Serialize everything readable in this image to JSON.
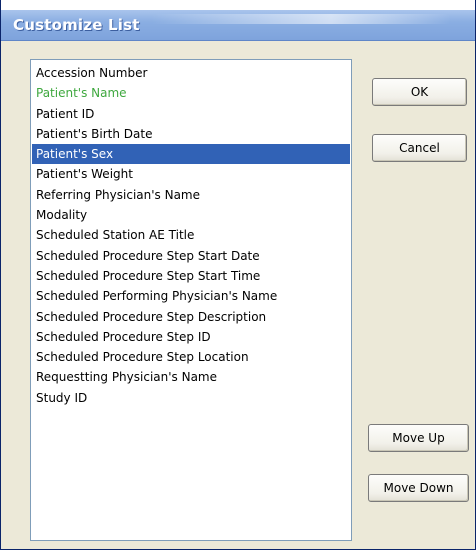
{
  "window": {
    "title": "Customize List"
  },
  "list": {
    "items": [
      {
        "label": "Accession Number"
      },
      {
        "label": "Patient's Name"
      },
      {
        "label": "Patient ID"
      },
      {
        "label": "Patient's Birth Date"
      },
      {
        "label": "Patient's Sex"
      },
      {
        "label": "Patient's Weight"
      },
      {
        "label": "Referring Physician's Name"
      },
      {
        "label": "Modality"
      },
      {
        "label": "Scheduled Station AE Title"
      },
      {
        "label": "Scheduled Procedure Step Start Date"
      },
      {
        "label": "Scheduled Procedure Step Start Time"
      },
      {
        "label": "Scheduled Performing Physician's Name"
      },
      {
        "label": "Scheduled Procedure Step Description"
      },
      {
        "label": "Scheduled Procedure Step ID"
      },
      {
        "label": "Scheduled Procedure Step Location"
      },
      {
        "label": "Requestting Physician's Name"
      },
      {
        "label": "Study ID"
      }
    ],
    "selected_item": "Patient's Sex",
    "highlighted_item": "Patient's Name",
    "highlight_color": "#3fa83f",
    "selection_color": "#3162b6"
  },
  "buttons": {
    "ok_label": "OK",
    "cancel_label": "Cancel",
    "move_up_label": "Move Up",
    "move_down_label": "Move Down"
  }
}
